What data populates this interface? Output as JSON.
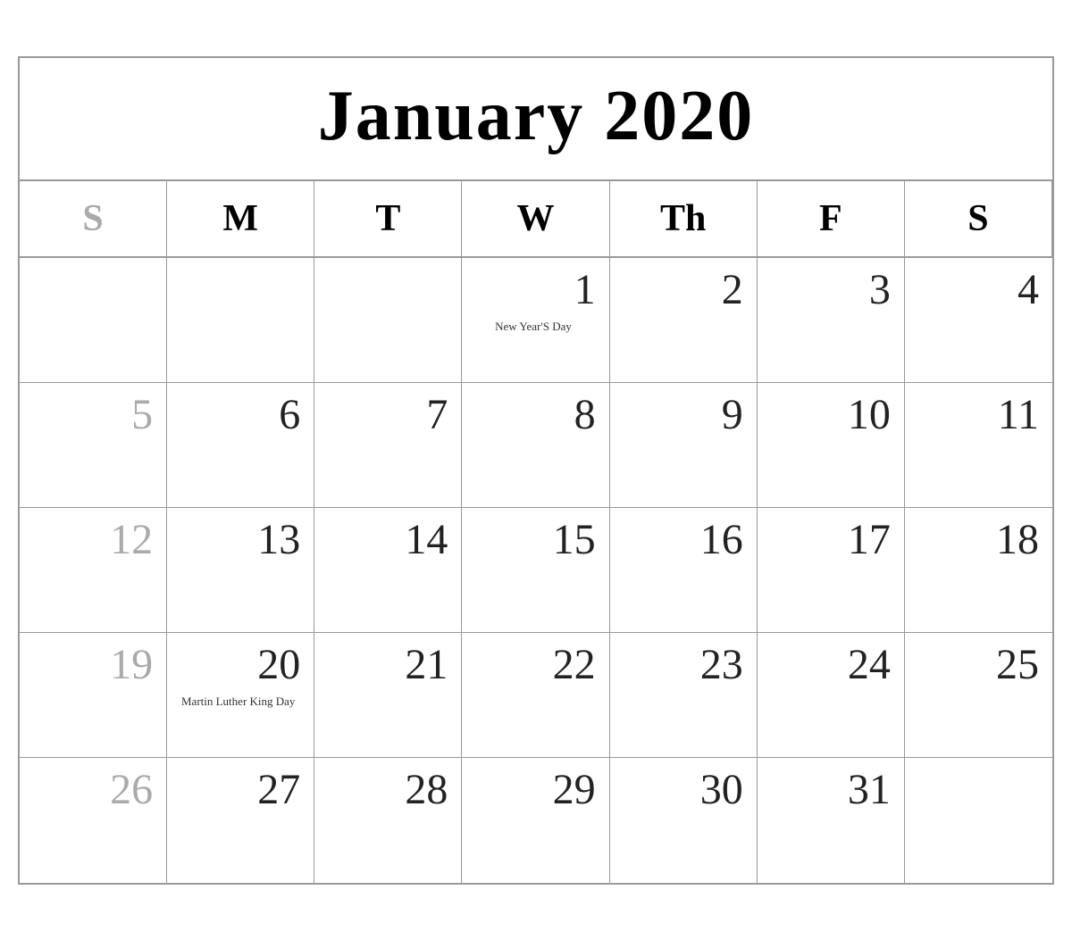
{
  "calendar": {
    "title": "January 2020",
    "year": 2020,
    "month": "January",
    "day_headers": [
      {
        "label": "S",
        "type": "sunday"
      },
      {
        "label": "M",
        "type": "monday"
      },
      {
        "label": "T",
        "type": "tuesday"
      },
      {
        "label": "W",
        "type": "wednesday"
      },
      {
        "label": "Th",
        "type": "thursday"
      },
      {
        "label": "F",
        "type": "friday"
      },
      {
        "label": "S",
        "type": "saturday"
      }
    ],
    "weeks": [
      {
        "days": [
          {
            "day": "",
            "type": "empty"
          },
          {
            "day": "",
            "type": "empty"
          },
          {
            "day": "",
            "type": "empty"
          },
          {
            "day": "1",
            "type": "regular",
            "holiday": "New Year'S Day"
          },
          {
            "day": "2",
            "type": "regular"
          },
          {
            "day": "3",
            "type": "regular"
          },
          {
            "day": "4",
            "type": "regular"
          }
        ]
      },
      {
        "days": [
          {
            "day": "5",
            "type": "sunday"
          },
          {
            "day": "6",
            "type": "regular"
          },
          {
            "day": "7",
            "type": "regular"
          },
          {
            "day": "8",
            "type": "regular"
          },
          {
            "day": "9",
            "type": "regular"
          },
          {
            "day": "10",
            "type": "regular"
          },
          {
            "day": "11",
            "type": "regular"
          }
        ]
      },
      {
        "days": [
          {
            "day": "12",
            "type": "sunday"
          },
          {
            "day": "13",
            "type": "regular"
          },
          {
            "day": "14",
            "type": "regular"
          },
          {
            "day": "15",
            "type": "regular"
          },
          {
            "day": "16",
            "type": "regular"
          },
          {
            "day": "17",
            "type": "regular"
          },
          {
            "day": "18",
            "type": "regular"
          }
        ]
      },
      {
        "days": [
          {
            "day": "19",
            "type": "sunday"
          },
          {
            "day": "20",
            "type": "regular",
            "holiday": "Martin Luther King Day"
          },
          {
            "day": "21",
            "type": "regular"
          },
          {
            "day": "22",
            "type": "regular"
          },
          {
            "day": "23",
            "type": "regular"
          },
          {
            "day": "24",
            "type": "regular"
          },
          {
            "day": "25",
            "type": "regular"
          }
        ]
      },
      {
        "last": true,
        "days": [
          {
            "day": "26",
            "type": "sunday"
          },
          {
            "day": "27",
            "type": "regular"
          },
          {
            "day": "28",
            "type": "regular"
          },
          {
            "day": "29",
            "type": "regular"
          },
          {
            "day": "30",
            "type": "regular"
          },
          {
            "day": "31",
            "type": "regular"
          },
          {
            "day": "",
            "type": "empty"
          }
        ]
      }
    ]
  }
}
